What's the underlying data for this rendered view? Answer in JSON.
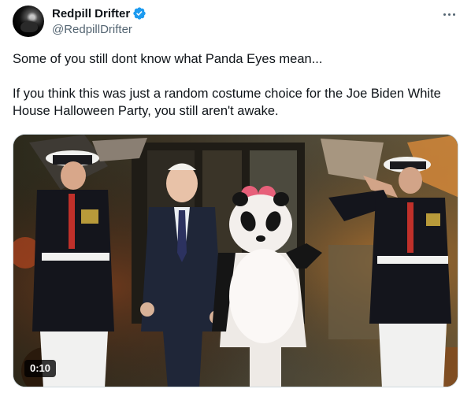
{
  "post": {
    "author": {
      "display_name": "Redpill Drifter",
      "handle": "@RedpillDrifter",
      "verified_icon": "verified-badge-icon",
      "avatar_icon": "avatar"
    },
    "more_icon": "more-options-icon",
    "text": {
      "line1": "Some of you still dont know what Panda Eyes mean...",
      "line2": "If you think this was just a random costume choice for the Joe Biden White House Halloween Party, you still aren't awake."
    },
    "media": {
      "type": "video",
      "duration": "0:10"
    }
  },
  "colors": {
    "text_primary": "#0f1419",
    "text_secondary": "#536471",
    "verified_blue": "#1d9bf0",
    "border": "#cfd9de"
  }
}
